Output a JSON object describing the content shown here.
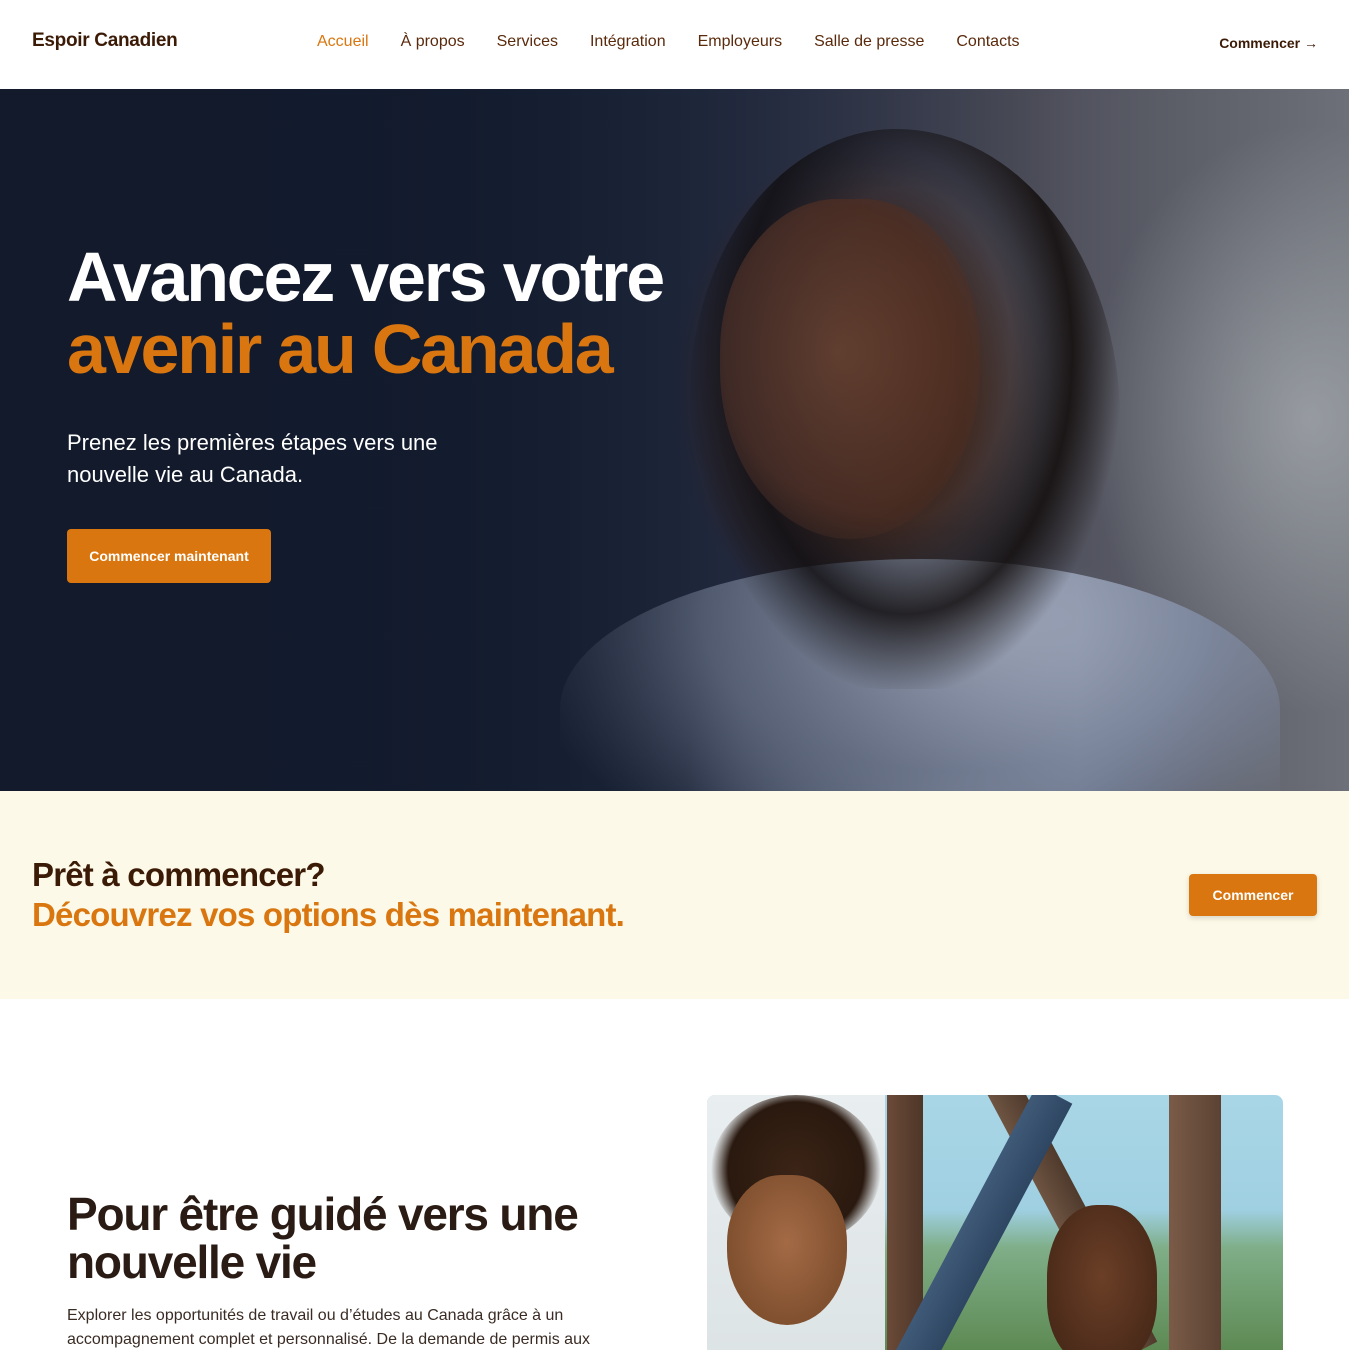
{
  "brand": {
    "name": "Espoir Canadien",
    "accent": "#d9760f",
    "dark": "#3b1a06"
  },
  "nav": {
    "items": [
      {
        "label": "Accueil",
        "active": true
      },
      {
        "label": "À propos",
        "active": false
      },
      {
        "label": "Services",
        "active": false
      },
      {
        "label": "Intégration",
        "active": false
      },
      {
        "label": "Employeurs",
        "active": false
      },
      {
        "label": "Salle de presse",
        "active": false
      },
      {
        "label": "Contacts",
        "active": false
      }
    ],
    "cta": "Commencer →"
  },
  "hero": {
    "title_line1": "Avancez vers votre",
    "title_line2": "avenir au Canada",
    "subtitle": "Prenez les premières étapes vers une nouvelle vie au Canada.",
    "button": "Commencer maintenant",
    "image": "woman-smiling-portrait"
  },
  "ready": {
    "line1": "Prêt à commencer?",
    "line2": "Découvrez vos options dès maintenant.",
    "button": "Commencer",
    "background": "#fdf9e8"
  },
  "guide": {
    "title": "Pour être guidé vers une nouvelle vie",
    "text": "Explorer les opportunités de travail ou d’études au Canada grâce à un accompagnement complet et personnalisé. De la demande de permis aux",
    "image": "smiling-couple-outdoors"
  }
}
